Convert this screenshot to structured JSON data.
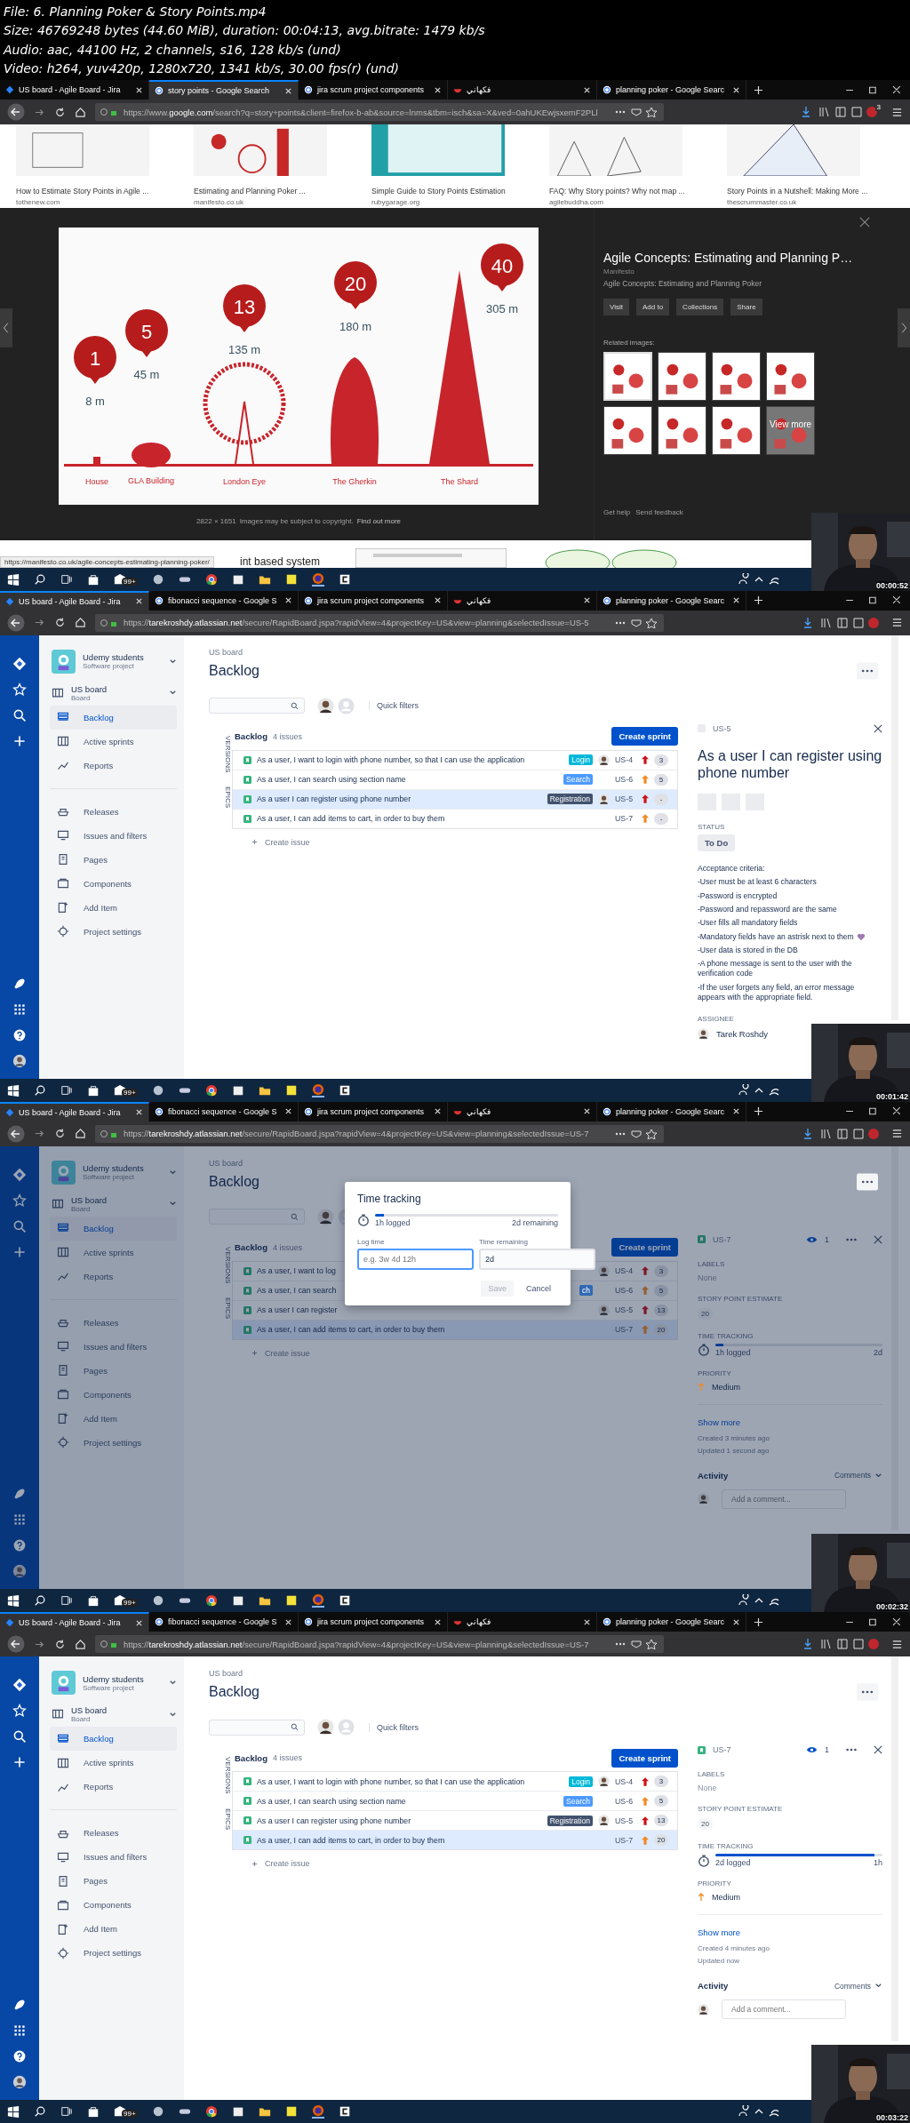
{
  "file_info": [
    "File: 6. Planning Poker & Story Points.mp4",
    "Size: 46769248 bytes (44.60 MiB), duration: 00:04:13, avg.bitrate: 1479 kb/s",
    "Audio: aac, 44100 Hz, 2 channels, s16, 128 kb/s (und)",
    "Video: h264, yuv420p, 1280x720, 1341 kb/s, 30.00 fps(r) (und)"
  ],
  "frames": [
    {
      "kind": "google",
      "tabs": [
        {
          "title": "US board - Agile Board - Jira",
          "selected": false
        },
        {
          "title": "story points - Google Search",
          "selected": true
        },
        {
          "title": "jira scrum project components",
          "selected": false
        },
        {
          "title": "فكهاني",
          "selected": false
        },
        {
          "title": "planning poker - Google Searc",
          "selected": false
        }
      ],
      "url": {
        "prefix": "https://www.",
        "domain": "google.com",
        "path": "/search?q=story+points&client=firefox-b-ab&source=lnms&tbm=isch&sa=X&ved=0ahUKEwjsxemF2PLl"
      },
      "addon_badge": "3",
      "results": [
        {
          "caption": "How to Estimate Story Points in Agile ...",
          "source": "tothenew.com"
        },
        {
          "caption": "Estimating and Planning Poker ...",
          "source": "manifesto.co.uk"
        },
        {
          "caption": "Simple Guide to Story Points Estimation",
          "source": "rubygarage.org"
        },
        {
          "caption": "FAQ: Why Story points? Why not map ...",
          "source": "agilebuddha.com"
        },
        {
          "caption": "Story Points in a Nutshell: Making More ...",
          "source": "thescrummaster.co.uk"
        }
      ],
      "preview": {
        "landmarks": [
          {
            "name": "House",
            "height": "8 m",
            "points": "1",
            "kind": "house"
          },
          {
            "name": "GLA Building",
            "height": "45 m",
            "points": "5",
            "kind": "dome"
          },
          {
            "name": "London Eye",
            "height": "135 m",
            "points": "13",
            "kind": "wheel"
          },
          {
            "name": "The Gherkin",
            "height": "180 m",
            "points": "20",
            "kind": "gherkin"
          },
          {
            "name": "The Shard",
            "height": "305 m",
            "points": "40",
            "kind": "spire"
          }
        ],
        "title": "Agile Concepts: Estimating and Planning P…",
        "site": "Manifesto",
        "subtitle": "Agile Concepts: Estimating and Planning Poker",
        "buttons": [
          "Visit",
          "Add to",
          "Collections",
          "Share"
        ],
        "related_label": "Related images:",
        "related": [
          {
            "selected": true
          },
          {
            "selected": false
          },
          {
            "selected": false
          },
          {
            "selected": false
          },
          {
            "selected": false
          },
          {
            "selected": false
          },
          {
            "selected": false
          },
          {
            "selected": false,
            "more": "View more"
          }
        ],
        "dimensions": "2822 × 1651",
        "copyright": "Images may be subject to copyright.",
        "find_out_more": "Find out more",
        "help": "Get help",
        "feedback": "Send feedback"
      },
      "below_text": "int based system",
      "status_url": "https://manifesto.co.uk/agile-concepts-estimating-planning-poker/",
      "taskbar_badge": "99+",
      "timestamp": "00:00:52"
    },
    {
      "kind": "jira",
      "tabs": [
        {
          "title": "US board - Agile Board - Jira",
          "selected": true
        },
        {
          "title": "fibonacci sequence - Google S",
          "selected": false
        },
        {
          "title": "jira scrum project components",
          "selected": false
        },
        {
          "title": "فكهاني",
          "selected": false
        },
        {
          "title": "planning poker - Google Searc",
          "selected": false
        }
      ],
      "url": {
        "prefix": "https://",
        "domain": "tarekroshdy.atlassian.net",
        "path": "/secure/RapidBoard.jspa?rapidView=4&projectKey=US&view=planning&selectedIssue=US-5"
      },
      "project": {
        "name": "Udemy students",
        "type": "Software project"
      },
      "board": {
        "name": "US board",
        "type": "Board"
      },
      "nav_main": [
        {
          "label": "Backlog",
          "selected": true
        },
        {
          "label": "Active sprints",
          "selected": false
        },
        {
          "label": "Reports",
          "selected": false
        }
      ],
      "nav_project": [
        {
          "label": "Releases"
        },
        {
          "label": "Issues and filters"
        },
        {
          "label": "Pages"
        },
        {
          "label": "Components"
        },
        {
          "label": "Add Item"
        },
        {
          "label": "Project settings"
        }
      ],
      "breadcrumb": "US board",
      "title": "Backlog",
      "quick_filters": "Quick filters",
      "side_tabs": [
        "VERSIONS",
        "EPICS"
      ],
      "backlog": {
        "name": "Backlog",
        "count": "4 issues",
        "create_sprint": "Create sprint",
        "create_issue": "Create issue",
        "issues": [
          {
            "summary": "As a user, I want to login with phone number, so that I can use the application",
            "label": {
              "text": "Login",
              "color": "#00b8d9"
            },
            "avatar": true,
            "key": "US-4",
            "priority": {
              "color": "#cd1317"
            },
            "points": "3",
            "selected": false
          },
          {
            "summary": "As a user, I can search using section name",
            "label": {
              "text": "Search",
              "color": "#4c9aff"
            },
            "avatar": false,
            "key": "US-6",
            "priority": {
              "color": "#f08a24"
            },
            "points": "5",
            "selected": false
          },
          {
            "summary": "As a user I can register using phone number",
            "label": {
              "text": "Registration",
              "color": "#42526e"
            },
            "avatar": true,
            "key": "US-5",
            "priority": {
              "color": "#cd1317"
            },
            "points": "-",
            "selected": true
          },
          {
            "summary": "As a user, I can add items to cart, in order to buy them",
            "avatar": false,
            "key": "US-7",
            "priority": {
              "color": "#f08a24"
            },
            "points": "-",
            "selected": false
          }
        ]
      },
      "detail": {
        "kind": "description",
        "key": "US-5",
        "summary": "As a user I can register using phone number",
        "status_label": "STATUS",
        "status": "To Do",
        "description": [
          {
            "text": "Acceptance criteria:",
            "heart": false
          },
          {
            "text": "-User must be at least 6 characters",
            "heart": false
          },
          {
            "text": "-Password is encrypted",
            "heart": false
          },
          {
            "text": "-Password and repassword are the same",
            "heart": false
          },
          {
            "text": "-User fills all mandatory fields",
            "heart": false
          },
          {
            "text": "-Mandatory fields have an astrisk next to them",
            "heart": true
          },
          {
            "text": "-User data is stored in the DB",
            "heart": false
          },
          {
            "text": "-A phone message is sent to the user with the verification code",
            "heart": false
          },
          {
            "text": "-If the user forgets any field, an error message appears with the appropriate field.",
            "heart": false
          }
        ],
        "assignee_label": "ASSIGNEE",
        "assignee": "Tarek Roshdy"
      },
      "taskbar_badge": "99+",
      "timestamp": "00:01:42"
    },
    {
      "kind": "jira",
      "tabs": [
        {
          "title": "US board - Agile Board - Jira",
          "selected": true
        },
        {
          "title": "fibonacci sequence - Google S",
          "selected": false
        },
        {
          "title": "jira scrum project components",
          "selected": false
        },
        {
          "title": "فكهاني",
          "selected": false
        },
        {
          "title": "planning poker - Google Searc",
          "selected": false
        }
      ],
      "url": {
        "prefix": "https://",
        "domain": "tarekroshdy.atlassian.net",
        "path": "/secure/RapidBoard.jspa?rapidView=4&projectKey=US&view=planning&selectedIssue=US-7"
      },
      "project": {
        "name": "Udemy students",
        "type": "Software project"
      },
      "board": {
        "name": "US board",
        "type": "Board"
      },
      "nav_main": [
        {
          "label": "Backlog",
          "selected": true
        },
        {
          "label": "Active sprints",
          "selected": false
        },
        {
          "label": "Reports",
          "selected": false
        }
      ],
      "nav_project": [
        {
          "label": "Releases"
        },
        {
          "label": "Issues and filters"
        },
        {
          "label": "Pages"
        },
        {
          "label": "Components"
        },
        {
          "label": "Add Item"
        },
        {
          "label": "Project settings"
        }
      ],
      "breadcrumb": "US board",
      "title": "Backlog",
      "side_tabs": [
        "VERSIONS",
        "EPICS"
      ],
      "backlog": {
        "name": "Backlog",
        "count": "4 issues",
        "create_sprint": "Create sprint",
        "create_issue": "Create issue",
        "issues": [
          {
            "summary": "As a user, I want to log",
            "avatar": true,
            "key": "US-4",
            "priority": {
              "color": "#7f1728"
            },
            "points": "3",
            "selected": false
          },
          {
            "summary": "As a user, I can search",
            "label": {
              "text": "ch",
              "color": "#3168b3"
            },
            "avatar": false,
            "key": "US-6",
            "priority": {
              "color": "#945f30"
            },
            "points": "5",
            "selected": false
          },
          {
            "summary": "As a user I can register",
            "avatar": true,
            "key": "US-5",
            "priority": {
              "color": "#7f1728"
            },
            "points": "13",
            "selected": false
          },
          {
            "summary": "As a user, I can add items to cart, in order to buy them",
            "avatar": false,
            "key": "US-7",
            "priority": {
              "color": "#945f30"
            },
            "points": "20",
            "selected": true
          }
        ]
      },
      "modal": {
        "title": "Time tracking",
        "level": 0.05,
        "logged": "1h logged",
        "remaining": "2d remaining",
        "log_label": "Log time",
        "log_placeholder": "e.g. 3w 4d 12h",
        "remaining_label": "Time remaining",
        "remaining_value": "2d",
        "save": "Save",
        "save_disabled": true,
        "cancel": "Cancel"
      },
      "detail": {
        "kind": "fields",
        "key": "US-7",
        "watchers": "1",
        "labels_label": "LABELS",
        "labels": "None",
        "estimate_label": "STORY POINT ESTIMATE",
        "estimate": "20",
        "tracking_label": "TIME TRACKING",
        "tracking": {
          "level": 0.05,
          "logged": "1h logged",
          "remaining": "2d"
        },
        "priority_label": "PRIORITY",
        "priority": "Medium",
        "show_more": "Show more",
        "created": "Created 3 minutes ago",
        "updated": "Updated 1 second ago",
        "activity": "Activity",
        "comments": "Comments",
        "comment_placeholder": "Add a comment..."
      },
      "taskbar_badge": "99+",
      "timestamp": "00:02:32"
    },
    {
      "kind": "jira",
      "tabs": [
        {
          "title": "US board - Agile Board - Jira",
          "selected": true
        },
        {
          "title": "fibonacci sequence - Google S",
          "selected": false
        },
        {
          "title": "jira scrum project components",
          "selected": false
        },
        {
          "title": "فكهاني",
          "selected": false
        },
        {
          "title": "planning poker - Google Searc",
          "selected": false
        }
      ],
      "url": {
        "prefix": "https://",
        "domain": "tarekroshdy.atlassian.net",
        "path": "/secure/RapidBoard.jspa?rapidView=4&projectKey=US&view=planning&selectedIssue=US-7"
      },
      "project": {
        "name": "Udemy students",
        "type": "Software project"
      },
      "board": {
        "name": "US board",
        "type": "Board"
      },
      "nav_main": [
        {
          "label": "Backlog",
          "selected": true
        },
        {
          "label": "Active sprints",
          "selected": false
        },
        {
          "label": "Reports",
          "selected": false
        }
      ],
      "nav_project": [
        {
          "label": "Releases"
        },
        {
          "label": "Issues and filters"
        },
        {
          "label": "Pages"
        },
        {
          "label": "Components"
        },
        {
          "label": "Add Item"
        },
        {
          "label": "Project settings"
        }
      ],
      "breadcrumb": "US board",
      "title": "Backlog",
      "quick_filters": "Quick filters",
      "side_tabs": [
        "VERSIONS",
        "EPICS"
      ],
      "backlog": {
        "name": "Backlog",
        "count": "4 issues",
        "create_sprint": "Create sprint",
        "create_issue": "Create issue",
        "issues": [
          {
            "summary": "As a user, I want to login with phone number, so that I can use the application",
            "label": {
              "text": "Login",
              "color": "#00b8d9"
            },
            "avatar": true,
            "key": "US-4",
            "priority": {
              "color": "#cd1317"
            },
            "points": "3",
            "selected": false
          },
          {
            "summary": "As a user, I can search using section name",
            "label": {
              "text": "Search",
              "color": "#4c9aff"
            },
            "avatar": false,
            "key": "US-6",
            "priority": {
              "color": "#f08a24"
            },
            "points": "5",
            "selected": false
          },
          {
            "summary": "As a user I can register using phone number",
            "label": {
              "text": "Registration",
              "color": "#42526e"
            },
            "avatar": true,
            "key": "US-5",
            "priority": {
              "color": "#cd1317"
            },
            "points": "13",
            "selected": false
          },
          {
            "summary": "As a user, I can add items to cart, in order to buy them",
            "avatar": false,
            "key": "US-7",
            "priority": {
              "color": "#f08a24"
            },
            "points": "20",
            "selected": true
          }
        ]
      },
      "detail": {
        "kind": "fields",
        "key": "US-7",
        "watchers": "1",
        "labels_label": "LABELS",
        "labels": "None",
        "estimate_label": "STORY POINT ESTIMATE",
        "estimate": "20",
        "tracking_label": "TIME TRACKING",
        "tracking": {
          "level": 0.95,
          "logged": "2d logged",
          "remaining": "1h"
        },
        "priority_label": "PRIORITY",
        "priority": "Medium",
        "show_more": "Show more",
        "created": "Created 4 minutes ago",
        "updated": "Updated now",
        "activity": "Activity",
        "comments": "Comments",
        "comment_placeholder": "Add a comment..."
      },
      "taskbar_badge": "99+",
      "timestamp": "00:03:22"
    }
  ]
}
